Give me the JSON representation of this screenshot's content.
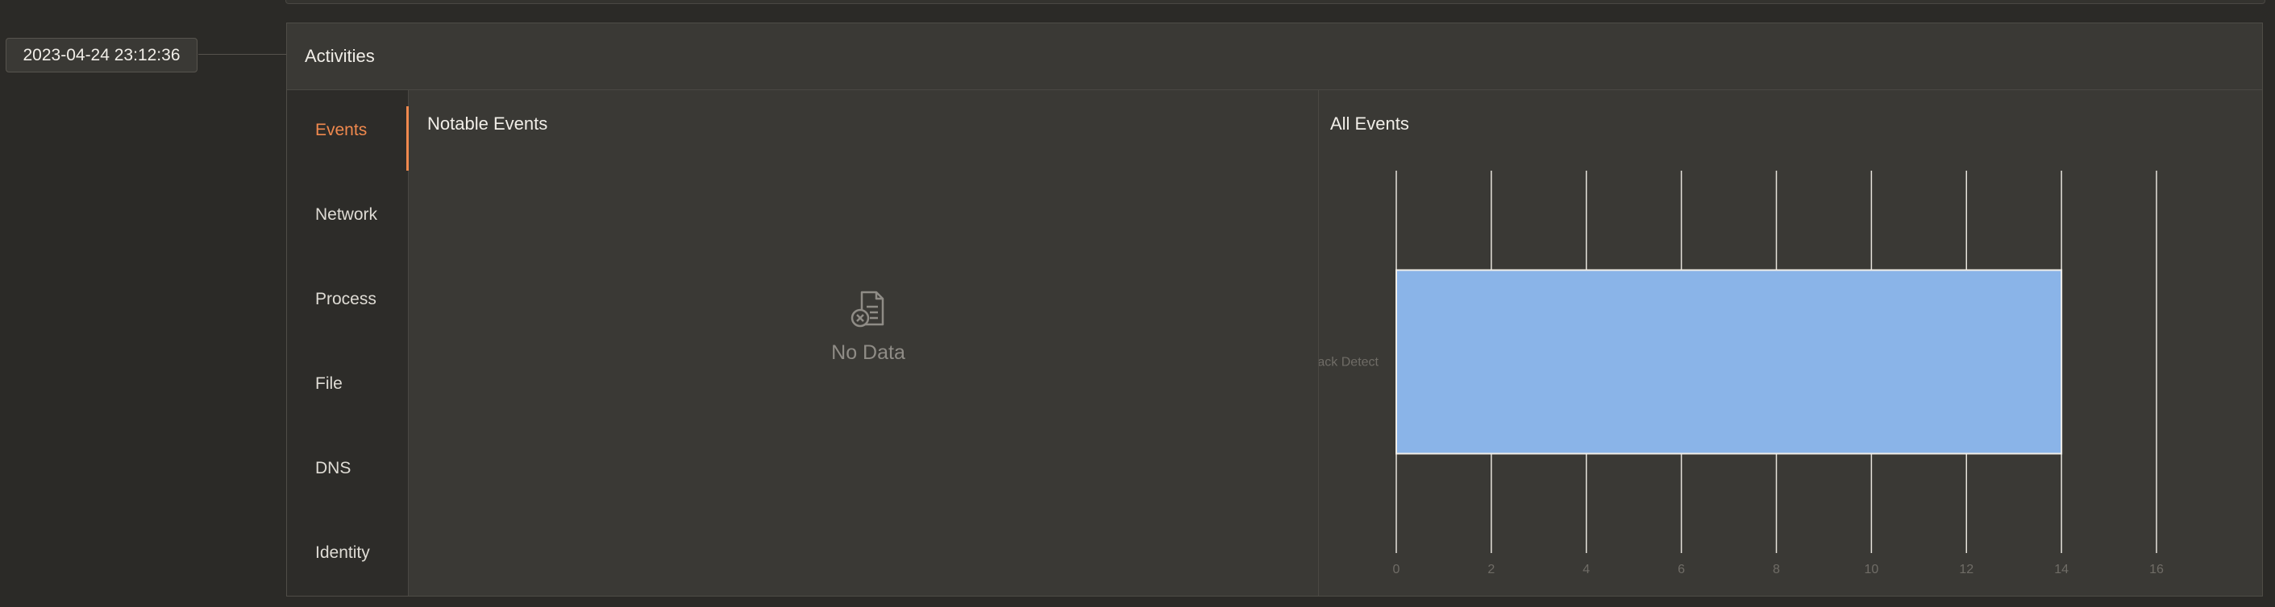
{
  "timestamp": "2023-04-24 23:12:36",
  "panel": {
    "title": "Activities"
  },
  "tabs": [
    {
      "label": "Events",
      "active": true
    },
    {
      "label": "Network",
      "active": false
    },
    {
      "label": "Process",
      "active": false
    },
    {
      "label": "File",
      "active": false
    },
    {
      "label": "DNS",
      "active": false
    },
    {
      "label": "Identity",
      "active": false
    }
  ],
  "notable_events": {
    "title": "Notable Events",
    "empty_icon": "no-data-document-icon",
    "empty_text": "No Data"
  },
  "all_events": {
    "title": "All Events"
  },
  "colors": {
    "accent": "#f0894e",
    "bar": "#8ab4e8",
    "background": "#2b2a27",
    "panel": "#3a3935"
  },
  "chart_data": {
    "type": "bar",
    "orientation": "horizontal",
    "categories": [
      "Attack Detect"
    ],
    "values": [
      14
    ],
    "xlim": [
      0,
      16
    ],
    "xticks": [
      0,
      2,
      4,
      6,
      8,
      10,
      12,
      14,
      16
    ],
    "grid": true
  }
}
